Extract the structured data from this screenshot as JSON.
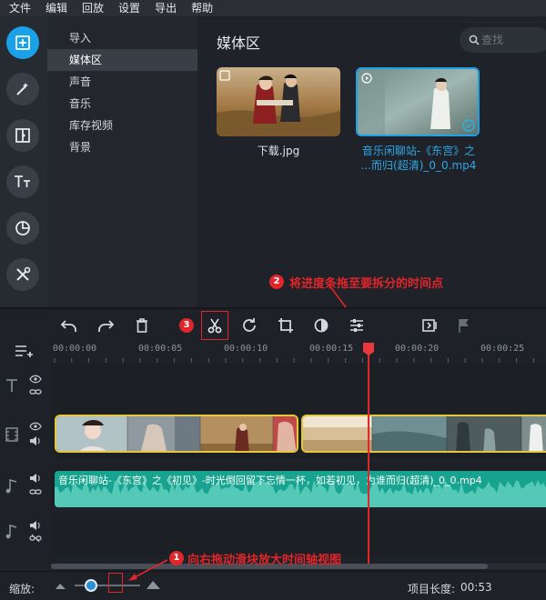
{
  "menu": [
    "文件",
    "编辑",
    "回放",
    "设置",
    "导出",
    "帮助"
  ],
  "tools": [
    {
      "icon": "import-plus-icon"
    },
    {
      "icon": "magic-wand-icon"
    },
    {
      "icon": "transition-icon"
    },
    {
      "icon": "title-text-icon"
    },
    {
      "icon": "sticker-icon"
    },
    {
      "icon": "tools-icon"
    }
  ],
  "categories": [
    "导入",
    "媒体区",
    "声音",
    "音乐",
    "库存视频",
    "背景"
  ],
  "selected_category": "媒体区",
  "media": {
    "title": "媒体区",
    "search_placeholder": "查找",
    "items": [
      {
        "label": "下载.jpg",
        "type": "image"
      },
      {
        "label_line1": "音乐闲聊站-《东宫》之",
        "label_line2": "...而归(超清)_0_0.mp4",
        "type": "video"
      }
    ]
  },
  "annotations": {
    "step1_num": "1",
    "step1_text": "向右拖动滑块放大时间轴视图",
    "step2_num": "2",
    "step2_text": "将进度条拖至要拆分的时间点",
    "step3_num": "3"
  },
  "ruler": [
    "00:00:00",
    "00:00:05",
    "00:00:10",
    "00:00:15",
    "00:00:20",
    "00:00:25"
  ],
  "audio_clip_label": "音乐闲聊站-《东宫》之《初见》-时光倒回留下忘情一杯，如若初见，为谁而归(超清)_0_0.mp4",
  "status": {
    "zoom_label": "缩放:",
    "zoom_level": 0.25,
    "project_length_label": "项目长度:",
    "project_length": "00:53"
  },
  "colors": {
    "accent": "#1aa1e8",
    "annotation_red": "#e0262b",
    "clip_border": "#e5c73b",
    "audio_teal": "#17a38f"
  }
}
